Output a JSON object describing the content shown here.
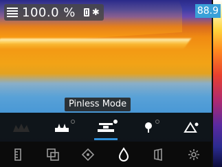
{
  "status": {
    "reading": "100.0 %",
    "icons": [
      "moisture-mode-icon",
      "battery-icon",
      "bluetooth-icon"
    ]
  },
  "scale": {
    "max_value": "88.9",
    "accent": "#3aa0d8"
  },
  "tooltip": {
    "label": "Pinless Mode"
  },
  "modes": [
    {
      "name": "mode-1",
      "icon": "material-icon",
      "disabled": true
    },
    {
      "name": "mode-2",
      "icon": "pin-mode-icon",
      "dot": "outline"
    },
    {
      "name": "mode-3",
      "icon": "pinless-mode-icon",
      "dot": "filled",
      "active": true
    },
    {
      "name": "mode-4",
      "icon": "probe-mode-icon",
      "dot": "outline"
    },
    {
      "name": "mode-5",
      "icon": "delta-mode-icon"
    }
  ],
  "nav": [
    {
      "name": "nav-ruler",
      "icon": "ruler-icon"
    },
    {
      "name": "nav-overlay",
      "icon": "overlay-icon"
    },
    {
      "name": "nav-target",
      "icon": "target-icon"
    },
    {
      "name": "nav-moisture",
      "icon": "droplet-icon",
      "active": true
    },
    {
      "name": "nav-palette",
      "icon": "palette-icon"
    },
    {
      "name": "nav-settings",
      "icon": "gear-icon"
    }
  ]
}
